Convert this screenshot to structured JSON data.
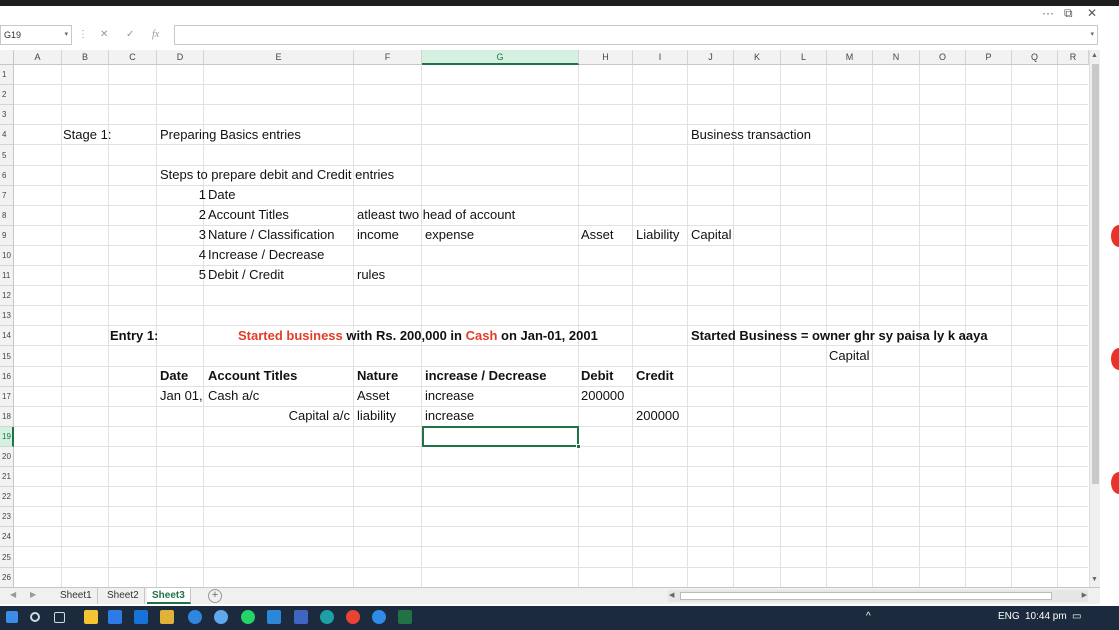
{
  "window": {
    "more_label": "···",
    "restore_label": "⧉",
    "close_label": "✕"
  },
  "formula_bar": {
    "name_box": "G19",
    "cancel": "✕",
    "enter": "✓",
    "fx": "fx",
    "formula": ""
  },
  "columns": [
    "A",
    "B",
    "C",
    "D",
    "E",
    "F",
    "G",
    "H",
    "I",
    "J",
    "K",
    "L",
    "M",
    "N",
    "O",
    "P",
    "Q",
    "R"
  ],
  "rows": [
    "1",
    "2",
    "3",
    "4",
    "5",
    "6",
    "7",
    "8",
    "9",
    "10",
    "11",
    "12",
    "13",
    "14",
    "15",
    "16",
    "17",
    "18",
    "19",
    "20",
    "21",
    "22",
    "23",
    "24",
    "25",
    "26"
  ],
  "cells": {
    "b4": "Stage 1:",
    "d4": "Preparing Basics entries",
    "j4": "Business transaction",
    "d6": "Steps to prepare debit and Credit entries",
    "step1_no": "1",
    "step1": "Date",
    "step2_no": "2",
    "step2": "Account Titles",
    "step2_note": "atleast two head of account",
    "step3_no": "3",
    "step3": "Nature / Classification",
    "nature_income": "income",
    "nature_expense": "expense",
    "nature_asset": "Asset",
    "nature_liability": "Liability",
    "nature_capital": "Capital",
    "step4_no": "4",
    "step4": "Increase / Decrease",
    "step5_no": "5",
    "step5": "Debit / Credit",
    "step5_note": "rules",
    "entry_label": "Entry 1:",
    "entry_part1": "Started business",
    "entry_part2": " with Rs. 200,000 in ",
    "entry_part3": "Cash",
    "entry_part4": " on Jan-01, 2001",
    "entry_note": "Started Business = owner ghr sy paisa ly k aaya",
    "entry_note2": "Capital",
    "hdr_date": "Date",
    "hdr_titles": "Account Titles",
    "hdr_nature": "Nature",
    "hdr_incdec": "increase / Decrease",
    "hdr_debit": "Debit",
    "hdr_credit": "Credit",
    "r17_date": "Jan 01,",
    "r17_title": "Cash a/c",
    "r17_nature": "Asset",
    "r17_incdec": "increase",
    "r17_debit": "200000",
    "r18_title": "Capital a/c",
    "r18_nature": "liability",
    "r18_incdec": "increase",
    "r18_credit": "200000"
  },
  "selected_cell": "G19",
  "sheets": [
    "Sheet1",
    "Sheet2",
    "Sheet3"
  ],
  "active_sheet": "Sheet3",
  "add_sheet": "+",
  "tray": {
    "lang": "ENG",
    "time": "10:44 pm"
  },
  "colors": {
    "accent": "#217346",
    "red_text": "#e23d28",
    "taskbar": "#1b2b3d"
  }
}
